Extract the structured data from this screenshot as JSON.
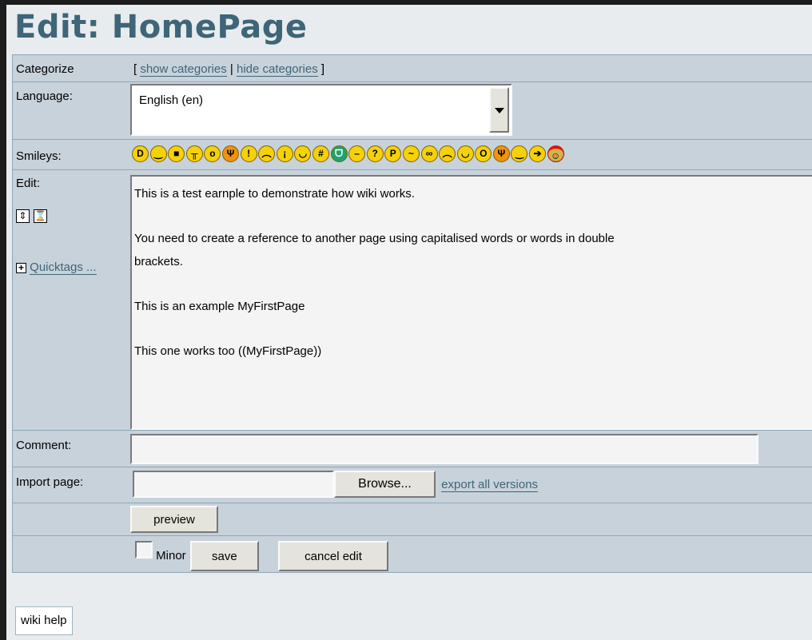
{
  "page_title": "Edit: HomePage",
  "categorize": {
    "label": "Categorize",
    "bracket_open": "[",
    "separator": "|",
    "bracket_close": "]",
    "show": "show categories",
    "hide": "hide categories"
  },
  "language": {
    "label": "Language:",
    "selected": "English (en)"
  },
  "smileys": {
    "label": "Smileys:",
    "items": [
      "biggrin",
      "smile",
      "cool",
      "cry",
      "eek",
      "evil",
      "exclaim",
      "frown",
      "idea",
      "lol",
      "mad",
      "mrgreen",
      "neutral",
      "question",
      "razz",
      "redface",
      "rolleyes",
      "sad",
      "smile2",
      "surprised",
      "twisted",
      "wink",
      "arrow",
      "santa"
    ]
  },
  "edit": {
    "label": "Edit:",
    "quicktags": "Quicktags ...",
    "lines": [
      "This is a test earnple to demonstrate how wiki works.",
      "",
      "You need to create a reference to another page using capitalised words or words in double",
      "brackets.",
      "",
      "This is an example MyFirstPage",
      "",
      "This one works too ((MyFirstPage))"
    ]
  },
  "comment": {
    "label": "Comment:",
    "value": ""
  },
  "import": {
    "label": "Import page:",
    "browse": "Browse...",
    "export": "export all versions"
  },
  "buttons": {
    "preview": "preview",
    "minor": "Minor",
    "save": "save",
    "cancel": "cancel edit"
  },
  "wiki_help": "wiki help"
}
